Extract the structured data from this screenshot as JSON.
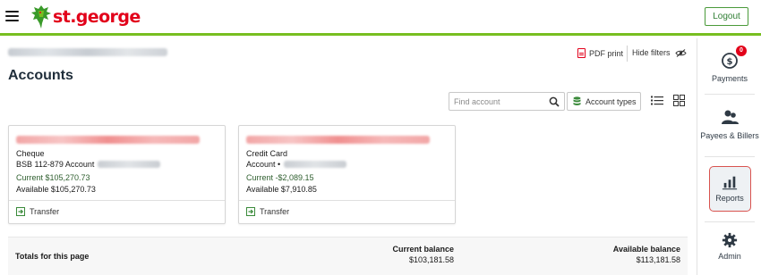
{
  "header": {
    "brand": "st.george",
    "logout_label": "Logout"
  },
  "main": {
    "title": "Accounts",
    "pdf_print_label": "PDF print",
    "hide_filters_label": "Hide filters",
    "search": {
      "placeholder": "Find account",
      "value": ""
    },
    "account_types_label": "Account types",
    "accounts": [
      {
        "type": "Cheque",
        "number_prefix": "BSB 112-879 Account",
        "current": "Current $105,270.73",
        "available": "Available $105,270.73",
        "action": "Transfer"
      },
      {
        "type": "Credit Card",
        "number_prefix": "Account •",
        "current": "Current -$2,089.15",
        "available": "Available $7,910.85",
        "action": "Transfer"
      }
    ],
    "totals": {
      "label": "Totals for this page",
      "current_header": "Current balance",
      "current_value": "$103,181.58",
      "available_header": "Available balance",
      "available_value": "$113,181.58"
    }
  },
  "sidebar": {
    "payments": {
      "label": "Payments",
      "badge": "0"
    },
    "payees": {
      "label": "Payees & Billers"
    },
    "reports": {
      "label": "Reports"
    },
    "admin": {
      "label": "Admin"
    }
  },
  "colors": {
    "brand_red": "#e2001a",
    "brand_green": "#78be20",
    "highlight_border": "#d9534f"
  }
}
